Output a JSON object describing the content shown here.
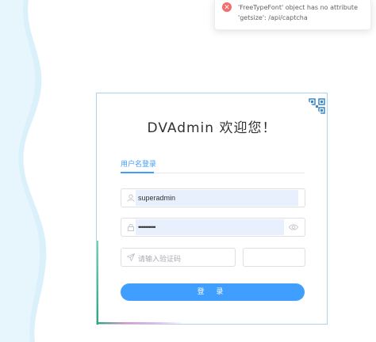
{
  "notification": {
    "icon": "error-circle-icon",
    "message": "'FreeTypeFont' object has no attribute 'getsize': /api/captcha",
    "color": "#f56c6c"
  },
  "login": {
    "title": "DVAdmin 欢迎您！",
    "tab_label": "用户名登录",
    "username_value": "superadmin",
    "password_value": "••••••••••",
    "captcha_placeholder": "请输入验证码",
    "submit_label": "登 录"
  },
  "colors": {
    "accent": "#409eff",
    "autofill": "#e8f0fe",
    "left_wave": "#daf0fb",
    "card_border": "#a9d4f0"
  },
  "icons": [
    "user-icon",
    "lock-icon",
    "eye-icon",
    "send-icon",
    "qr-code-icon"
  ]
}
